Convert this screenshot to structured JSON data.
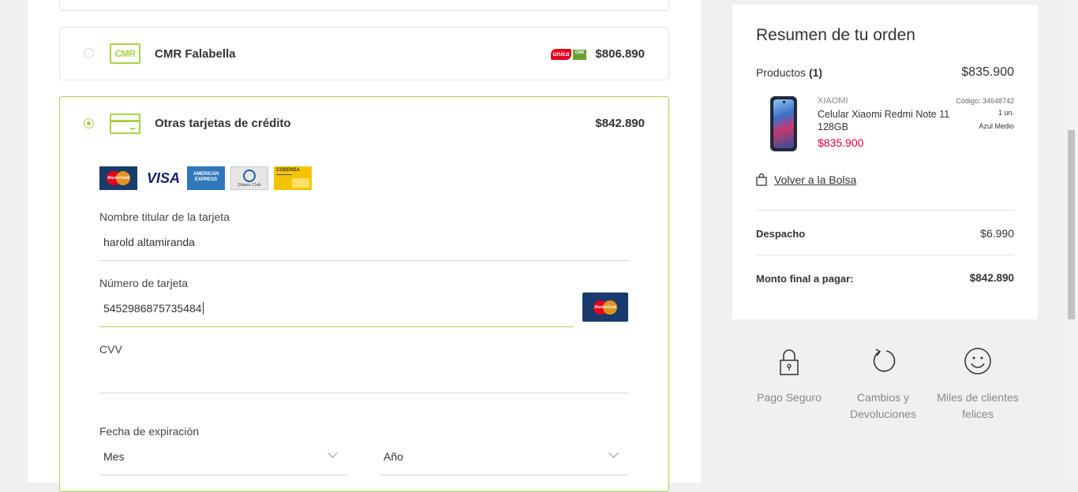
{
  "payment_options": {
    "cmr": {
      "title": "CMR Falabella",
      "icon_text": "CMR",
      "unica_badge": "unica",
      "cmr_badge": "CMR",
      "price": "$806.890"
    },
    "other": {
      "title": "Otras tarjetas de crédito",
      "price": "$842.890"
    }
  },
  "card_brands": {
    "mastercard_word": "MasterCard",
    "visa": "VISA",
    "amex": "AMERICAN EXPRESS",
    "diners": "Diners Club",
    "codensa": "CODENSA"
  },
  "form": {
    "holder_label": "Nombre titular de la tarjeta",
    "holder_value": "harold altamiranda",
    "number_label": "Número de tarjeta",
    "number_value": "5452986875735484",
    "cvv_label": "CVV",
    "cvv_value": "",
    "expiry_label": "Fecha de expiración",
    "month_value": "Mes",
    "year_value": "Año"
  },
  "summary": {
    "title": "Resumen de tu orden",
    "products_label": "Productos",
    "products_count": "(1)",
    "products_total": "$835.900",
    "product": {
      "brand": "XIAOMI",
      "name": "Celular Xiaomi Redmi Note 11 128GB",
      "price": "$835.900",
      "code": "Código: 34648742",
      "quantity": "1 un.",
      "color": "Azul Medio"
    },
    "back_link": "Volver a la Bolsa",
    "shipping_label": "Despacho",
    "shipping_value": "$6.990",
    "total_label": "Monto final a pagar:",
    "total_value": "$842.890"
  },
  "benefits": [
    {
      "icon": "lock-icon",
      "label": "Pago Seguro"
    },
    {
      "icon": "return-icon",
      "label": "Cambios y Devoluciones"
    },
    {
      "icon": "smiley-icon",
      "label": "Miles de clientes felices"
    }
  ],
  "colors": {
    "accent_green": "#aad04b",
    "price_red": "#e0003c",
    "mastercard_navy": "#1a3b6c"
  }
}
